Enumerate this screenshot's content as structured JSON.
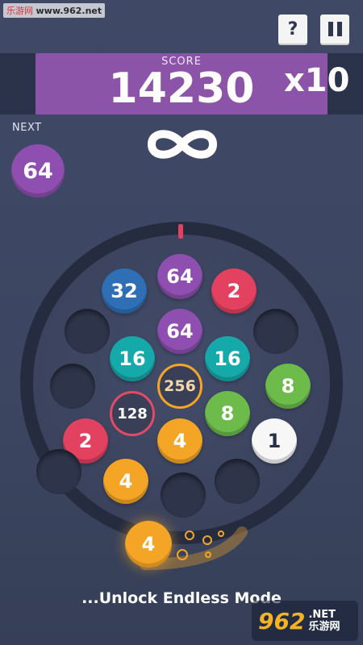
{
  "watermark_top": {
    "site_cn": "乐游网",
    "url": "www.962.net"
  },
  "buttons": {
    "help_label": "?",
    "pause_label": "pause"
  },
  "score": {
    "label": "SCORE",
    "value": "14230",
    "multiplier": "x10"
  },
  "next": {
    "label": "NEXT",
    "value": "64",
    "color": "#8e4fb0"
  },
  "mode_icon": "infinity-icon",
  "board": {
    "balls": [
      {
        "value": "64",
        "color": "#8e4fb0",
        "kind": "filled"
      },
      {
        "value": "32",
        "color": "#2f6fb6",
        "kind": "filled"
      },
      {
        "value": "2",
        "color": "#e2415f",
        "kind": "filled"
      },
      {
        "value": "64",
        "color": "#8e4fb0",
        "kind": "filled"
      },
      {
        "value": "16",
        "color": "#16a9a9",
        "kind": "filled"
      },
      {
        "value": "16",
        "color": "#16a9a9",
        "kind": "filled"
      },
      {
        "value": "256",
        "color": "#f5a526",
        "kind": "ring"
      },
      {
        "value": "8",
        "color": "#6dbb4b",
        "kind": "filled"
      },
      {
        "value": "8",
        "color": "#6dbb4b",
        "kind": "filled"
      },
      {
        "value": "128",
        "color": "#e24b66",
        "kind": "ring"
      },
      {
        "value": "2",
        "color": "#e2415f",
        "kind": "filled"
      },
      {
        "value": "4",
        "color": "#f5a526",
        "kind": "filled"
      },
      {
        "value": "1",
        "color": "#f7f7f7",
        "kind": "white"
      },
      {
        "value": "4",
        "color": "#f5a526",
        "kind": "filled"
      }
    ],
    "empty_slots": 6
  },
  "launcher": {
    "value": "4",
    "color": "#f5a526"
  },
  "footer": {
    "text": "...Unlock Endless Mode"
  },
  "watermark_logo": {
    "num": "962",
    "suffix": ".NET",
    "cn": "乐游网"
  },
  "colors": {
    "background": "#3f4966",
    "score_box": "#8c54a8",
    "ring": "#222a3c"
  }
}
